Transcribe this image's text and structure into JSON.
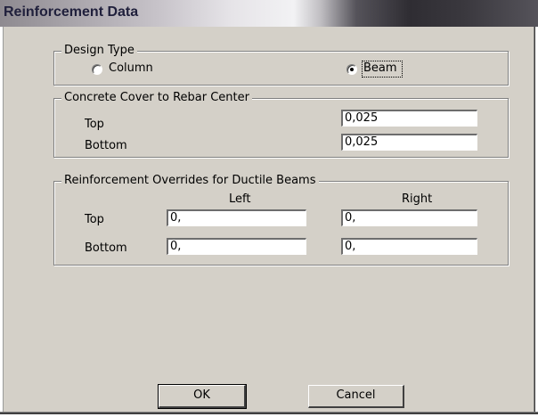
{
  "window": {
    "title": "Reinforcement Data"
  },
  "design_type": {
    "legend": "Design Type",
    "options": [
      {
        "label": "Column",
        "selected": false
      },
      {
        "label": "Beam",
        "selected": true
      }
    ]
  },
  "cover": {
    "legend": "Concrete Cover to Rebar Center",
    "top_label": "Top",
    "top_value": "0,025",
    "bottom_label": "Bottom",
    "bottom_value": "0,025"
  },
  "overrides": {
    "legend": "Reinforcement Overrides for Ductile Beams",
    "left_header": "Left",
    "right_header": "Right",
    "top_label": "Top",
    "top_left": "0,",
    "top_right": "0,",
    "bottom_label": "Bottom",
    "bottom_left": "0,",
    "bottom_right": "0,"
  },
  "buttons": {
    "ok": "OK",
    "cancel": "Cancel"
  }
}
